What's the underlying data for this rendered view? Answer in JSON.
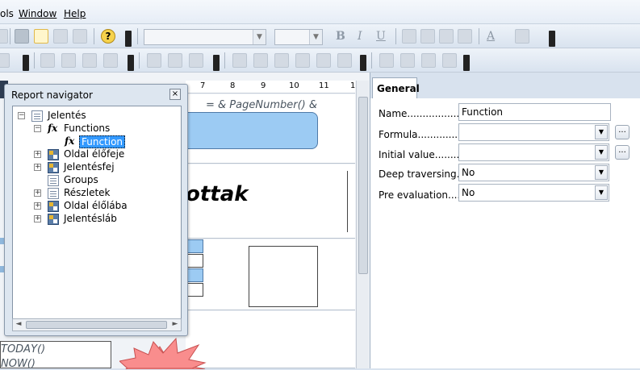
{
  "menu": {
    "items": [
      "ols",
      "Window",
      "Help"
    ]
  },
  "toolbar": {
    "font_name": "",
    "font_size": "",
    "bold": "B",
    "italic": "I",
    "underline": "U",
    "font_color": "A",
    "help": "?"
  },
  "ruler": [
    "7",
    "8",
    "9",
    "10",
    "11",
    "1"
  ],
  "report": {
    "page_number_field": "= & PageNumber() &",
    "title_fragment": "ottak",
    "today_field": "TODAY()",
    "now_field": "NOW()"
  },
  "navigator": {
    "title": "Report navigator",
    "close": "×",
    "tree": {
      "root": "Jelentés",
      "functions": "Functions",
      "function": "Function",
      "page_header": "Oldal élőfeje",
      "report_header": "Jelentésfej",
      "groups": "Groups",
      "details": "Részletek",
      "page_footer": "Oldal élőlába",
      "report_footer": "Jelentésláb"
    }
  },
  "properties": {
    "tab": "General",
    "name_label": "Name......................",
    "name_value": "Function",
    "formula_label": "Formula...................",
    "formula_value": "",
    "initial_label": "Initial value............",
    "initial_value": "",
    "deep_label": "Deep traversing.....",
    "deep_value": "No",
    "pre_label": "Pre evaluation.......",
    "pre_value": "No",
    "ellipsis": "..."
  }
}
